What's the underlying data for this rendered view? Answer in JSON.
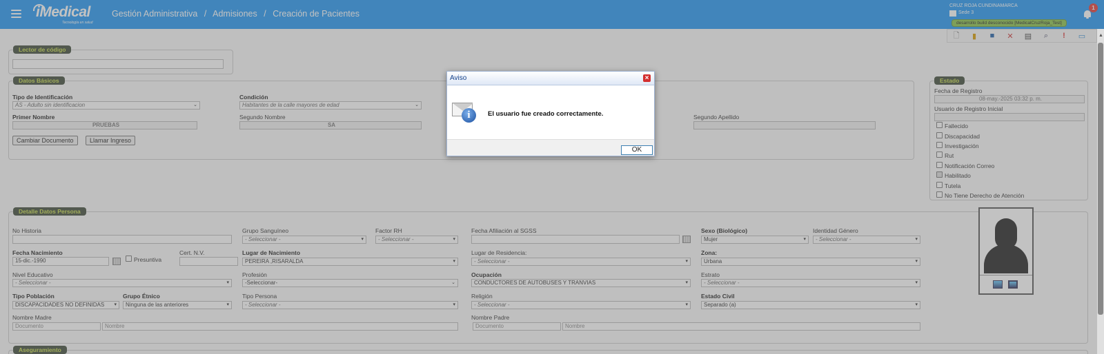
{
  "header": {
    "logo_text": "iMedical",
    "logo_tagline": "Tecnología en salud",
    "breadcrumb": [
      "Gestión Administrativa",
      "/",
      "Admisiones",
      "/",
      "Creación de Pacientes"
    ],
    "org_name": "CRUZ ROJA CUNDINAMARCA",
    "sede": "Sede 3",
    "env_badge": "desarrollo build desconocido [MedicalCruzRoja_Test]",
    "notification_count": "1",
    "brand_color": "#2196f3"
  },
  "toolbar": {
    "icons": [
      "new-document-icon",
      "open-folder-icon",
      "save-icon",
      "delete-icon",
      "print-icon",
      "search-document-icon",
      "help-icon",
      "chat-icon"
    ]
  },
  "lector": {
    "legend": "Lector de código"
  },
  "datos_basicos": {
    "legend": "Datos Básicos",
    "tipo_id_label": "Tipo de Identificación",
    "tipo_id_value": "AS - Adulto sin identificacion",
    "condicion_label": "Condición",
    "condicion_value": "Habitantes de la calle mayores de edad",
    "primer_nombre_label": "Primer Nombre",
    "primer_nombre_value": "PRUEBAS",
    "segundo_nombre_label": "Segundo Nombre",
    "segundo_nombre_value": "SA",
    "segundo_apellido_label": "Segundo Apellido",
    "btn_cambiar": "Cambiar Documento",
    "btn_llamar": "Llamar Ingreso"
  },
  "estado": {
    "legend": "Estado",
    "fecha_registro_label": "Fecha de Registro",
    "fecha_registro_value": "08-may.-2025 03:32 p. m.",
    "usuario_registro_label": "Usuario de Registro Inicial",
    "checkboxes": [
      "Fallecido",
      "Discapacidad",
      "Investigación",
      "Rut",
      "Notificación Correo",
      "Habilitado",
      "Tutela",
      "No Tiene Derecho de Atención"
    ]
  },
  "detalle": {
    "legend": "Detalle Datos Persona",
    "no_historia": "No Historia",
    "grupo_sanguineo": "Grupo Sanguíneo",
    "grupo_sanguineo_value": "- Seleccionar -",
    "factor_rh": "Factor RH",
    "factor_rh_value": "- Seleccionar -",
    "fecha_afiliacion": "Fecha Afiliación al SGSS",
    "sexo": "Sexo (Biológico)",
    "sexo_value": "Mujer",
    "identidad": "Identidad Género",
    "identidad_value": "- Seleccionar -",
    "fecha_nac": "Fecha Nacimiento",
    "fecha_nac_value": "15-dic.-1990",
    "presuntiva": "Presuntiva",
    "cert": "Cert. N.V.",
    "lugar_nac": "Lugar de Nacimiento",
    "lugar_nac_value": "PEREIRA ,RISARALDA",
    "lugar_res": "Lugar de Residencia:",
    "lugar_res_value": "- Seleccionar -",
    "zona": "Zona:",
    "zona_value": "Urbana",
    "nivel_edu": "Nivel Educativo",
    "nivel_edu_value": "- Seleccionar -",
    "profesion": "Profesión",
    "profesion_value": "-Seleccionar-",
    "ocupacion": "Ocupación",
    "ocupacion_value": "CONDUCTORES DE AUTOBUSES Y TRANVIAS",
    "estrato": "Estrato",
    "estrato_value": "- Seleccionar -",
    "tipo_poblacion": "Tipo Población",
    "tipo_poblacion_value": "DISCAPACIDADES NO DEFINIDAS",
    "grupo_etnico": "Grupo Étnico",
    "grupo_etnico_value": "Ninguna de las anteriores",
    "tipo_persona": "Tipo Persona",
    "tipo_persona_value": "- Seleccionar -",
    "religion": "Religión",
    "religion_value": "- Seleccionar -",
    "estado_civil": "Estado Civil",
    "estado_civil_value": "Separado (a)",
    "nombre_madre": "Nombre Madre",
    "nombre_padre": "Nombre Padre",
    "doc_placeholder": "Documento",
    "nombre_placeholder": "Nombre"
  },
  "aseguramiento": {
    "legend": "Aseguramiento"
  },
  "dialog": {
    "title": "Aviso",
    "message": "El usuario fue creado correctamente.",
    "ok": "OK"
  }
}
